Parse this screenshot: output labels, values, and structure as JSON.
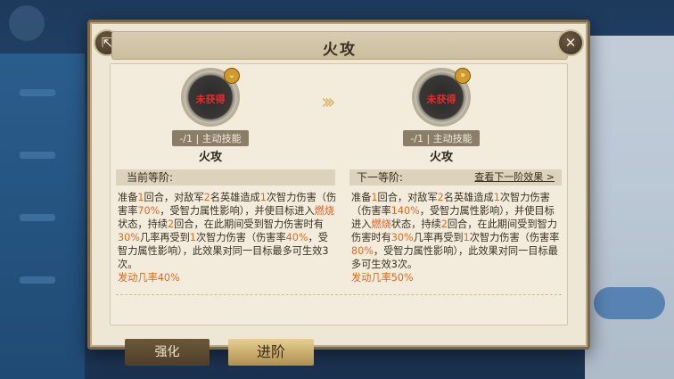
{
  "dialog": {
    "title": "火攻",
    "share_icon": "share-icon",
    "close_icon": "close-icon"
  },
  "skills": {
    "current": {
      "status": "未获得",
      "tag": "-/1 | 主动技能",
      "name": "火攻",
      "badge_icon": "chevron-down-icon"
    },
    "next": {
      "status": "未获得",
      "tag": "-/1 | 主动技能",
      "name": "火攻",
      "badge_icon": "double-chevron-icon"
    },
    "arrow_icon": "arrow-right-icon"
  },
  "tiers": {
    "current_label": "当前等阶:",
    "next_label": "下一等阶:",
    "view_next_label": "查看下一阶效果 >"
  },
  "descriptions": {
    "current": {
      "p1": "准备",
      "n1": "1",
      "p2": "回合，对敌军",
      "n2": "2",
      "p3": "名英雄造成",
      "n3": "1",
      "p4": "次智力伤害（伤害率",
      "n4": "70%",
      "p5": "，受智力属性影响），并使目标进入",
      "burn": "燃烧",
      "p6": "状态，持续",
      "n5": "2",
      "p7": "回合，在此期间受到智力伤害时有",
      "n6": "30%",
      "p8": "几率再受到",
      "n7": "1",
      "p9": "次智力伤害（伤害率",
      "n8": "40%",
      "p10": "，受智力属性影响），此效果对同一目标最多可生效3次。",
      "rate": "发动几率40%"
    },
    "next": {
      "p1": "准备",
      "n1": "1",
      "p2": "回合，对敌军",
      "n2": "2",
      "p3": "名英雄造成",
      "n3": "1",
      "p4": "次智力伤害（伤害率",
      "n4": "140%",
      "p5": "，受智力属性影响），并使目标进入",
      "burn": "燃烧",
      "p6": "状态，持续",
      "n5": "2",
      "p7": "回合，在此期间受到智力伤害时有",
      "n6": "30%",
      "p8": "几率再受到",
      "n7": "1",
      "p9": "次智力伤害（伤害率",
      "n8": "80%",
      "p10": "，受智力属性影响），此效果对同一目标最多可生效3次。",
      "rate": "发动几率50%"
    }
  },
  "tabs": {
    "enhance": "强化",
    "advance": "进阶"
  }
}
